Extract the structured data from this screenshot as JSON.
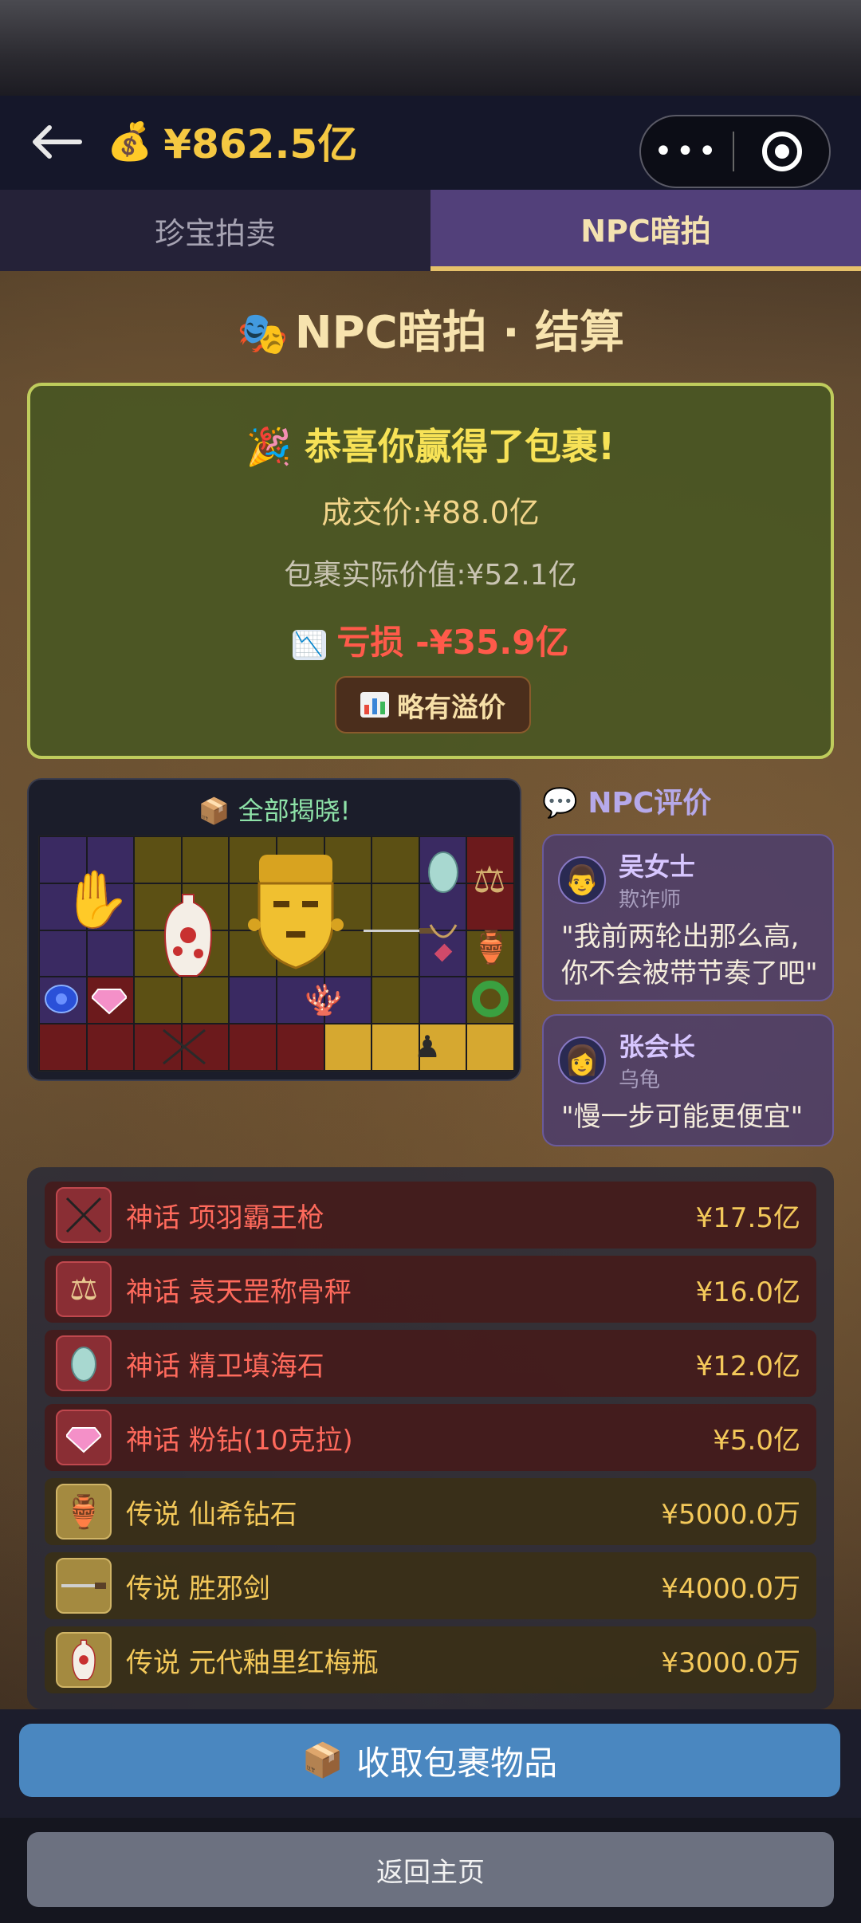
{
  "header": {
    "back_icon": "arrow-left-icon",
    "money_icon": "money-bag-icon",
    "balance": "¥862.5亿",
    "more_icon": "more-dots-icon",
    "close_icon": "target-circle-icon"
  },
  "tabs": [
    {
      "label": "珍宝拍卖",
      "active": false
    },
    {
      "label": "NPC暗拍",
      "active": true
    }
  ],
  "page_title": "NPC暗拍 · 结算",
  "result": {
    "congrats": "恭喜你赢得了包裹!",
    "deal_price": "成交价:¥88.0亿",
    "actual_value": "包裹实际价值:¥52.1亿",
    "loss": "亏损 -¥35.9亿",
    "verdict": "略有溢价"
  },
  "reveal": {
    "title": "全部揭晓!"
  },
  "npc_section": {
    "title": "NPC评价",
    "comments": [
      {
        "name": "吴女士",
        "role": "欺诈师",
        "quote_line1": "\"我前两轮出那么高,",
        "quote_line2": "你不会被带节奏了吧\""
      },
      {
        "name": "张会长",
        "role": "乌龟",
        "quote_line1": "\"慢一步可能更便宜\"",
        "quote_line2": ""
      }
    ]
  },
  "items": [
    {
      "tier": "神话",
      "name": "项羽霸王枪",
      "value": "¥17.5亿",
      "icon": "spear-icon"
    },
    {
      "tier": "神话",
      "name": "袁天罡称骨秤",
      "value": "¥16.0亿",
      "icon": "scale-icon"
    },
    {
      "tier": "神话",
      "name": "精卫填海石",
      "value": "¥12.0亿",
      "icon": "egg-stone-icon"
    },
    {
      "tier": "神话",
      "name": "粉钻(10克拉)",
      "value": "¥5.0亿",
      "icon": "pink-diamond-icon"
    },
    {
      "tier": "传说",
      "name": "仙希钻石",
      "value": "¥5000.0万",
      "icon": "diamond-statue-icon"
    },
    {
      "tier": "传说",
      "name": "胜邪剑",
      "value": "¥4000.0万",
      "icon": "sword-icon"
    },
    {
      "tier": "传说",
      "name": "元代釉里红梅瓶",
      "value": "¥3000.0万",
      "icon": "vase-icon"
    }
  ],
  "collect_button": "收取包裹物品",
  "home_button": "返回主页"
}
